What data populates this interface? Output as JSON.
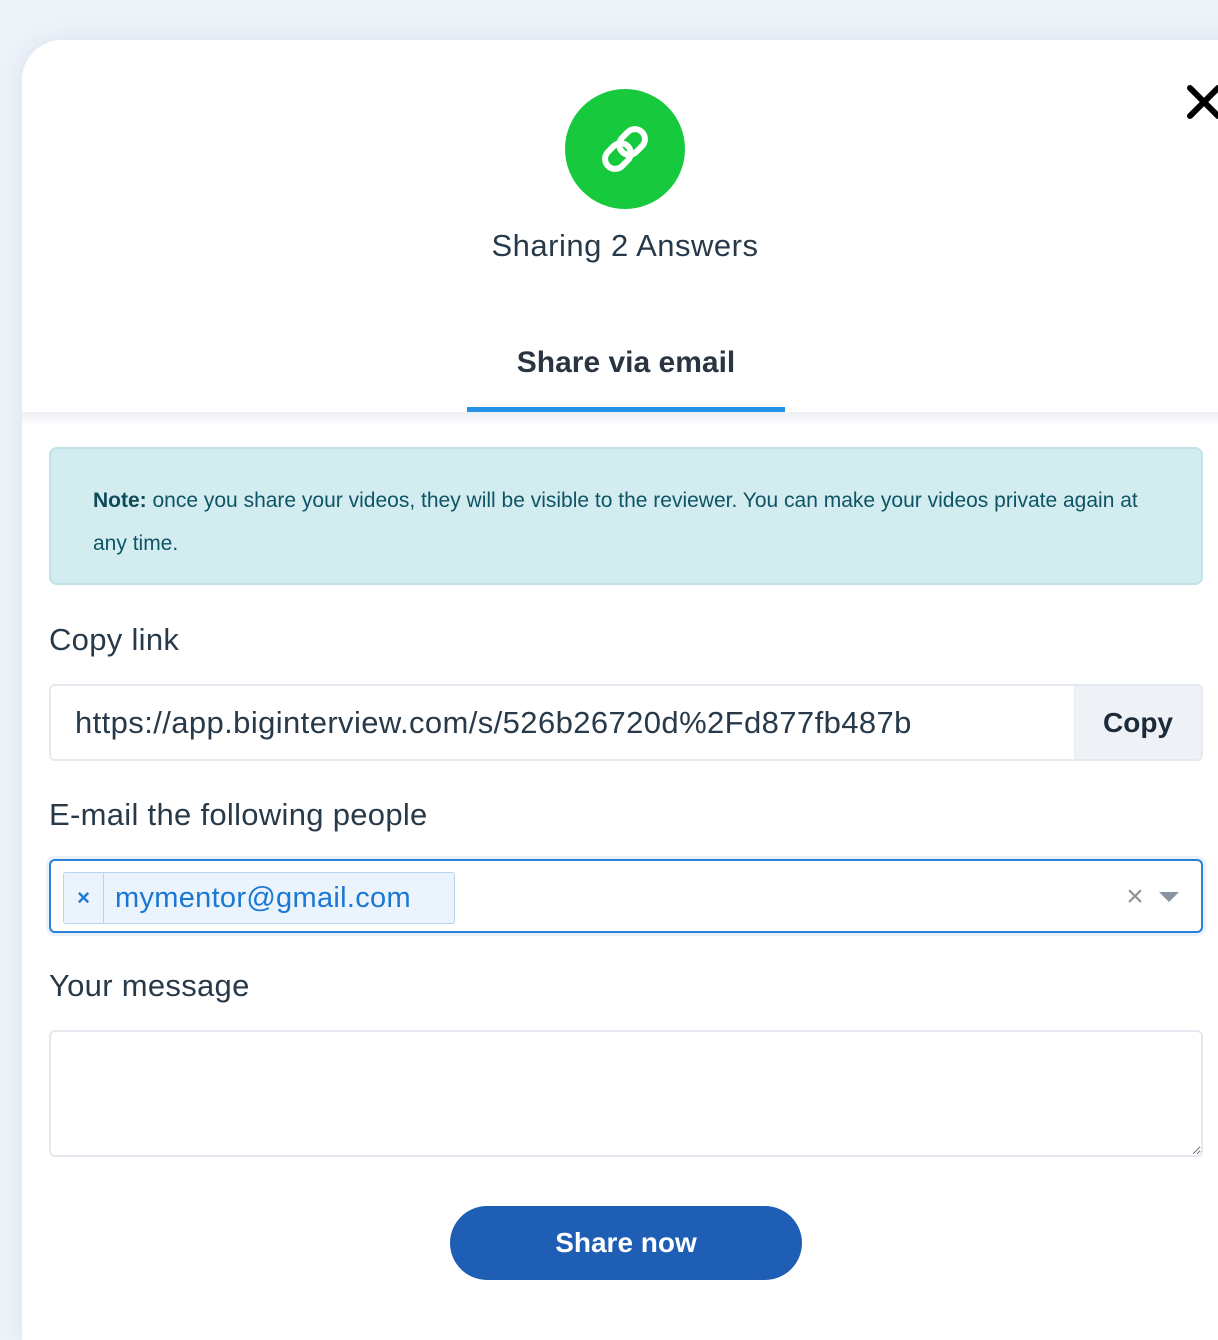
{
  "modal": {
    "title": "Sharing 2 Answers",
    "tab_label": "Share via email"
  },
  "note": {
    "prefix": "Note:",
    "text": " once you share your videos, they will be visible to the reviewer. You can make your videos private again at any time."
  },
  "copy_link": {
    "label": "Copy link",
    "value": "https://app.biginterview.com/s/526b26720d%2Fd877fb487b",
    "button_label": "Copy"
  },
  "email": {
    "label": "E-mail the following people",
    "recipients": [
      "mymentor@gmail.com"
    ],
    "remove_glyph": "×",
    "clear_glyph": "×"
  },
  "message": {
    "label": "Your message",
    "value": ""
  },
  "actions": {
    "submit_label": "Share now"
  },
  "colors": {
    "accent_green": "#16c93d",
    "tab_underline": "#2592e6",
    "primary_button": "#1f5eb5",
    "note_background": "#d3ecef"
  },
  "icons": {
    "close": "close-icon",
    "link": "link-icon",
    "dropdown": "chevron-down-icon"
  }
}
